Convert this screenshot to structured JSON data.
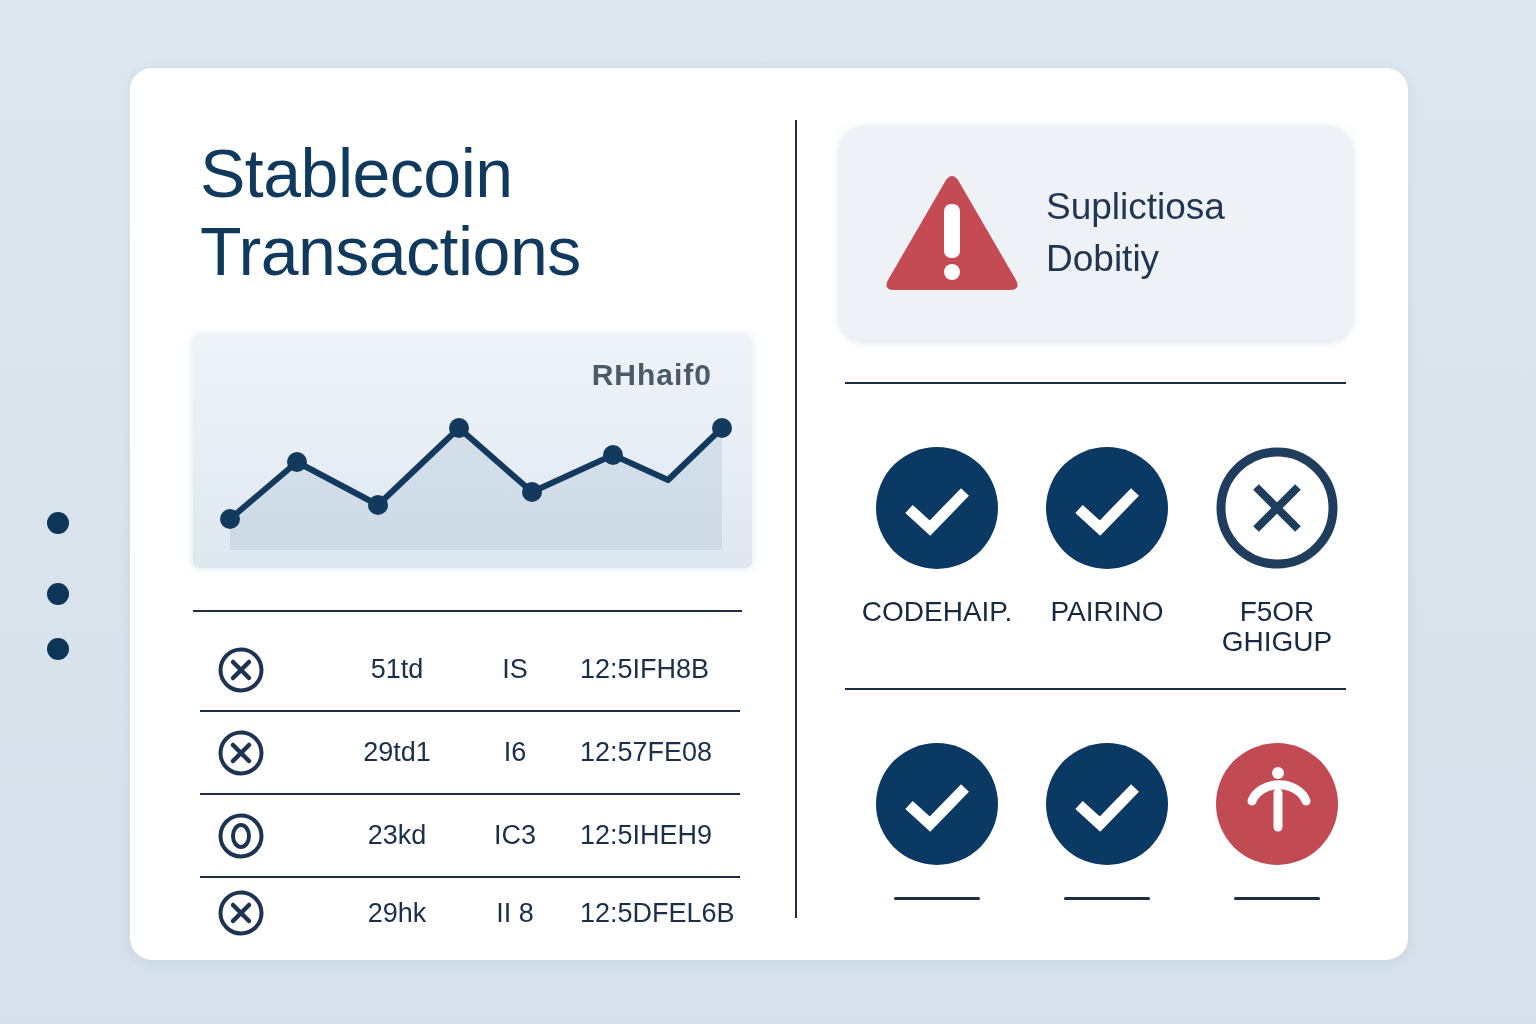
{
  "title": "Stablecoin Transactions",
  "chart": {
    "label": "RHhaif0"
  },
  "transactions": [
    {
      "kind": "cross",
      "column_2": "51td",
      "column_3": "IS",
      "column_4": "12:5IFH8B"
    },
    {
      "kind": "cross",
      "column_2": "29td1",
      "column_3": "I6",
      "column_4": "12:57FE08"
    },
    {
      "kind": "ring",
      "column_2": "23kd",
      "column_3": "IC3",
      "column_4": "12:5IHEH9"
    },
    {
      "kind": "cross",
      "column_2": "29hk",
      "column_3": "II 8",
      "column_4": "12:5DFEL6B"
    }
  ],
  "alert": {
    "text": "Suplictiosa Dobitiy"
  },
  "status_grid": [
    {
      "items": [
        {
          "kind": "check",
          "label": "CODEHAIP."
        },
        {
          "kind": "check",
          "label": "PAIRINO"
        },
        {
          "kind": "cross",
          "label": "F5OR GHIGUP"
        }
      ]
    },
    {
      "items": [
        {
          "kind": "check"
        },
        {
          "kind": "check"
        },
        {
          "kind": "warning"
        }
      ]
    }
  ]
}
